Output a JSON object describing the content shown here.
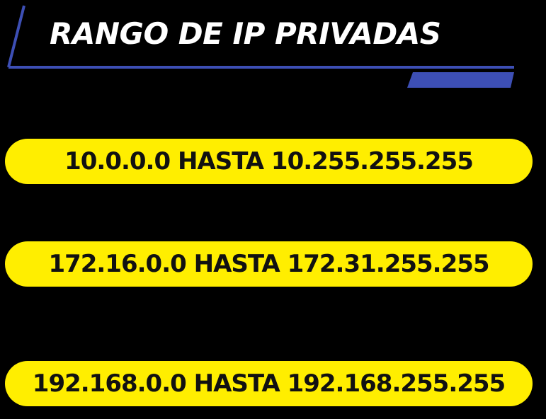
{
  "header": {
    "title": "RANGO DE IP PRIVADAS"
  },
  "ranges": [
    {
      "label": "10.0.0.0 HASTA 10.255.255.255"
    },
    {
      "label": "172.16.0.0 HASTA 172.31.255.255"
    },
    {
      "label": "192.168.0.0 HASTA 192.168.255.255"
    }
  ],
  "colors": {
    "background": "#000000",
    "title_text": "#ffffff",
    "frame_accent": "#3d4fb5",
    "pill_fill": "#ffee00",
    "pill_text": "#111111"
  }
}
